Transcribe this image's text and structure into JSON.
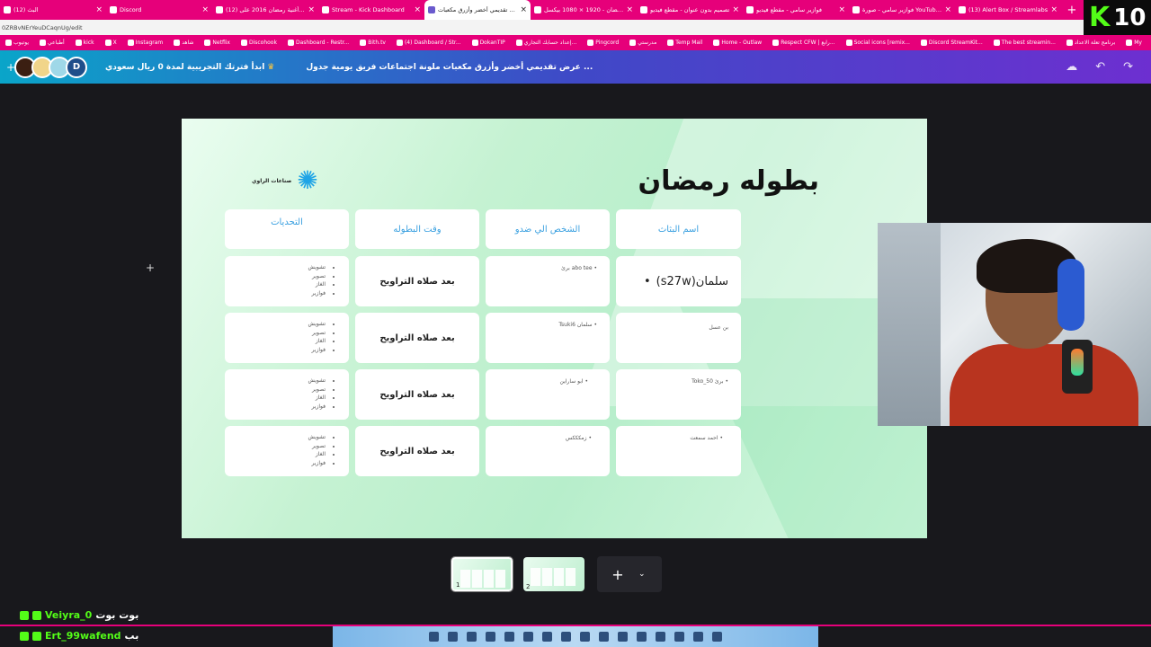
{
  "browser": {
    "tabs": [
      {
        "label": "(12) البث",
        "active": false
      },
      {
        "label": "Discord",
        "active": false
      },
      {
        "label": "(12) أغنية رمضان 2016 على YouTube",
        "active": false
      },
      {
        "label": "Stream - Kick Dashboard",
        "active": false
      },
      {
        "label": "عرض تقديمي أخضر وأزرق مكعبات",
        "active": true
      },
      {
        "label": "صورة رمضان - 1920 × 1080 بيكسل",
        "active": false
      },
      {
        "label": "تصميم بدون عنوان - مقطع فيديو",
        "active": false
      },
      {
        "label": "فوازير سامي - مقطع فيديو",
        "active": false
      },
      {
        "label": "فوازير سامي - صورة YouTube مصغ",
        "active": false
      },
      {
        "label": "(13) Alert Box / Streamlabs",
        "active": false
      }
    ],
    "new_tab": "+",
    "url": "0ZRBvNErYeuDCaqnUg/edit",
    "bookmarks": [
      "يوتيوب",
      "أطباعي",
      "kick",
      "X",
      "Instagram",
      "شاهد",
      "Netflix",
      "Discohook",
      "Dashboard - Restr...",
      "Bith.tv",
      "(4) Dashboard / Str...",
      "DokanTIP",
      "إعداد حسابك التجاري...",
      "Pingcord",
      "مدرستي",
      "Temp Mail",
      "Home - Outlaw",
      "Respect CFW | رابع...",
      "Social icons [remix...",
      "Discord StreamKit...",
      "The best streamin...",
      "برنامج تعلة الاعداد",
      "My"
    ]
  },
  "overlay": {
    "kick_letter": "K",
    "viewer_count": "10"
  },
  "canva": {
    "plus": "+",
    "avatars": [
      "",
      "",
      "",
      "D"
    ],
    "trial_text": "ابدأ فترتك التجريبية لمدة 0 ريال سعودي",
    "doc_title": "عرض تقديمي أخضر وأزرق مكعبات ملونة اجتماعات فريق يومية جدول ...",
    "header_icons": [
      "cloud-sync-icon",
      "undo-icon",
      "redo-icon"
    ]
  },
  "slide": {
    "title": "بطوله رمضان",
    "brand_text": "صناعات الراوي",
    "headers": [
      "اسم البثاث",
      "الشخص الي ضدو",
      "وقت البطوله",
      "التحديات"
    ],
    "rows": [
      {
        "streamer": "سلمان(s27w)",
        "opponent": "abo tee برئ",
        "time": "بعد صلاه التراويح",
        "challenges": [
          "تشويش",
          "تصوير",
          "الغاز",
          "فوازير"
        ]
      },
      {
        "streamer": "بن عسل",
        "opponent": "سلمان Tsuki6",
        "time": "بعد صلاه التراويح",
        "challenges": [
          "تشويش",
          "تصوير",
          "الغاز",
          "فوازير"
        ]
      },
      {
        "streamer": "برئ Toko_50",
        "opponent": "ابو ساراين",
        "time": "بعد صلاه التراويح",
        "challenges": [
          "تشويش",
          "تصوير",
          "الغاز",
          "فوازير"
        ]
      },
      {
        "streamer": "احمد سمعت",
        "opponent": "زمكككس",
        "time": "بعد صلاه التراويح",
        "challenges": [
          "تشويش",
          "تصوير",
          "الغاز",
          "فوازير"
        ]
      }
    ]
  },
  "thumbnails": [
    {
      "num": "1"
    },
    {
      "num": "2"
    }
  ],
  "thumb_add": {
    "plus": "+",
    "chevron": "⌄"
  },
  "chat": [
    {
      "user": "Veiyra_0",
      "message": "بوت بوت"
    },
    {
      "user": "Ert_99wafend",
      "message": "بب"
    }
  ],
  "colors": {
    "kick_green": "#53fc18",
    "brand_pink": "#e6007a",
    "canva_teal": "#0aa5c9",
    "canva_purple": "#6d2fd0",
    "header_blue": "#3aa0e0"
  }
}
